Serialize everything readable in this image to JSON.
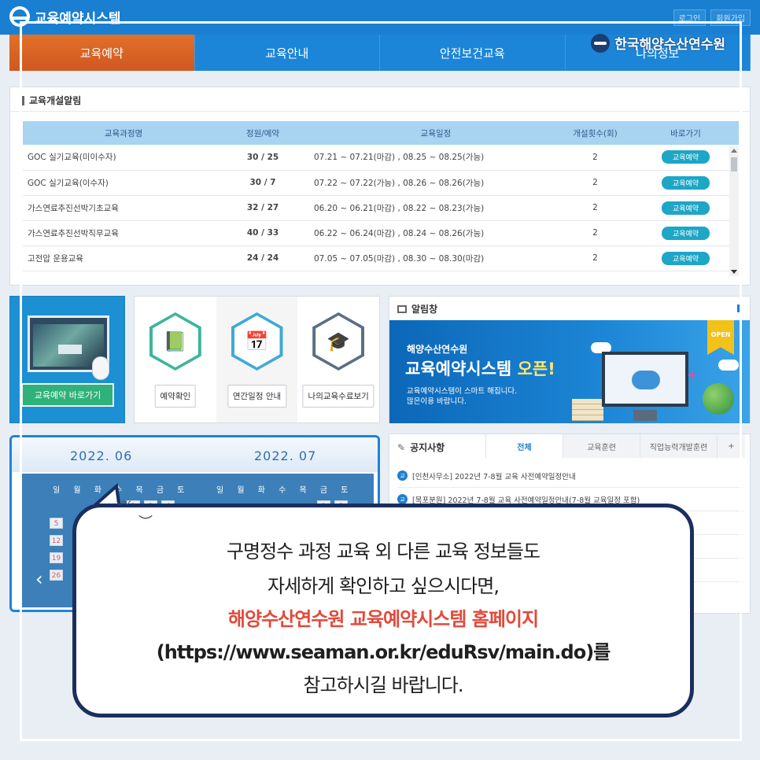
{
  "app": {
    "title": "교육예약시스템",
    "login": "로그인",
    "join": "회원가입"
  },
  "brand": {
    "name": "한국해양수산연수원"
  },
  "nav": {
    "tabs": [
      "교육예약",
      "교육안내",
      "안전보건교육",
      "나의정보"
    ]
  },
  "course_panel": {
    "title": "교육개설알림",
    "headers": {
      "name": "교육과정명",
      "capacity": "정원/예약",
      "schedule": "교육일정",
      "count": "개설횟수(회)",
      "shortcut": "바로가기"
    },
    "rows": [
      {
        "name": "GOC 실기교육(미이수자)",
        "capacity": "30 / 25",
        "schedule": "07.21 ~ 07.21(마감) , 08.25 ~ 08.25(가능)",
        "count": "2",
        "action": "교육예약"
      },
      {
        "name": "GOC 실기교육(이수자)",
        "capacity": "30 / 7",
        "schedule": "07.22 ~ 07.22(가능) , 08.26 ~ 08.26(가능)",
        "count": "2",
        "action": "교육예약"
      },
      {
        "name": "가스연료추진선박기초교육",
        "capacity": "32 / 27",
        "schedule": "06.20 ~ 06.21(마감) , 08.22 ~ 08.23(가능)",
        "count": "2",
        "action": "교육예약"
      },
      {
        "name": "가스연료추진선박직무교육",
        "capacity": "40 / 33",
        "schedule": "06.22 ~ 06.24(마감) , 08.24 ~ 08.26(가능)",
        "count": "2",
        "action": "교육예약"
      },
      {
        "name": "고전압 운용교육",
        "capacity": "24 / 24",
        "schedule": "07.05 ~ 07.05(마감) , 08.30 ~ 08.30(마감)",
        "count": "2",
        "action": "교육예약"
      }
    ]
  },
  "quick": {
    "go_label": "교육예약 바로가기",
    "items": [
      {
        "label": "예약확인",
        "icon": "book-plant-icon"
      },
      {
        "label": "연간일정 안내",
        "icon": "calendar-search-icon"
      },
      {
        "label": "나의교육수료보기",
        "icon": "graduation-cap-icon"
      }
    ]
  },
  "alarm": {
    "title": "알림창",
    "banner_sub": "해양수산연수원",
    "banner_main_prefix": "교육예약시스템 ",
    "banner_main_em": "오픈!",
    "banner_desc1": "교육예약시스템이 스마트 해집니다.",
    "banner_desc2": "많은이용 바랍니다.",
    "open_tag": "OPEN"
  },
  "calendar": {
    "month_left": "2022. 06",
    "month_right": "2022. 07",
    "dow": "일 월 화 수 목 금 토",
    "left_days": [
      "2",
      "3",
      "4",
      "5",
      "12",
      "19",
      "26"
    ],
    "right_days": [
      "1",
      "2"
    ]
  },
  "notices": {
    "title": "공지사항",
    "tabs": [
      "전체",
      "교육훈련",
      "직업능력개발훈련",
      "+"
    ],
    "badge": "교",
    "items": [
      "[인천사무소] 2022년 7-8월 교육 사전예약일정안내",
      "[목포분원] 2022년 7-8월 교육 사전예약일정안내(7-8월 교육일정 포함)"
    ]
  },
  "overlay": {
    "line1": "구명정수 과정 교육 외 다른 교육 정보들도",
    "line2": "자세하게 확인하고 싶으시다면,",
    "line3": "해양수산연수원 교육예약시스템 홈페이지",
    "line4": "(https://www.seaman.or.kr/eduRsv/main.do)를",
    "line5": "참고하시길 바랍니다."
  },
  "colors": {
    "primary": "#1a7fd0",
    "active_tab": "#e3702a",
    "navy": "#1b2f5e",
    "highlight": "#e24a3b",
    "go_button": "#1ea6c6"
  }
}
